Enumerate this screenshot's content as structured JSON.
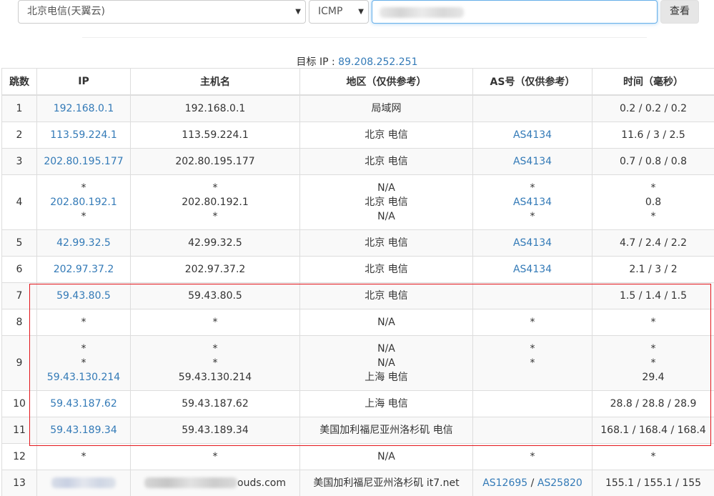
{
  "toolbar": {
    "region_value": "北京电信(天翼云)",
    "protocol_value": "ICMP",
    "query_label": "查看"
  },
  "target": {
    "label": "目标 IP : ",
    "ip": "89.208.252.251"
  },
  "table": {
    "headers": [
      "跳数",
      "IP",
      "主机名",
      "地区（仅供参考）",
      "AS号（仅供参考）",
      "时间（毫秒）"
    ],
    "rows": [
      {
        "hop": "1",
        "ips": [
          "192.168.0.1"
        ],
        "hosts": [
          "192.168.0.1"
        ],
        "regions": [
          "局域网"
        ],
        "asns": [],
        "times": [
          "0.2 / 0.2 / 0.2"
        ]
      },
      {
        "hop": "2",
        "ips": [
          "113.59.224.1"
        ],
        "hosts": [
          "113.59.224.1"
        ],
        "regions": [
          "北京 电信"
        ],
        "asns": [
          "AS4134"
        ],
        "times": [
          "11.6 / 3 / 2.5"
        ]
      },
      {
        "hop": "3",
        "ips": [
          "202.80.195.177"
        ],
        "hosts": [
          "202.80.195.177"
        ],
        "regions": [
          "北京 电信"
        ],
        "asns": [
          "AS4134"
        ],
        "times": [
          "0.7 / 0.8 / 0.8"
        ]
      },
      {
        "hop": "4",
        "ips": [
          "*",
          "202.80.192.1",
          "*"
        ],
        "hosts": [
          "*",
          "202.80.192.1",
          "*"
        ],
        "regions": [
          "N/A",
          "北京 电信",
          "N/A"
        ],
        "asns": [
          "*",
          "AS4134",
          "*"
        ],
        "times": [
          "*",
          "0.8",
          "*"
        ]
      },
      {
        "hop": "5",
        "ips": [
          "42.99.32.5"
        ],
        "hosts": [
          "42.99.32.5"
        ],
        "regions": [
          "北京 电信"
        ],
        "asns": [
          "AS4134"
        ],
        "times": [
          "4.7 / 2.4 / 2.2"
        ]
      },
      {
        "hop": "6",
        "ips": [
          "202.97.37.2"
        ],
        "hosts": [
          "202.97.37.2"
        ],
        "regions": [
          "北京 电信"
        ],
        "asns": [
          "AS4134"
        ],
        "times": [
          "2.1 / 3 / 2"
        ]
      },
      {
        "hop": "7",
        "ips": [
          "59.43.80.5"
        ],
        "hosts": [
          "59.43.80.5"
        ],
        "regions": [
          "北京 电信"
        ],
        "asns": [],
        "times": [
          "1.5 / 1.4 / 1.5"
        ]
      },
      {
        "hop": "8",
        "ips": [
          "*"
        ],
        "hosts": [
          "*"
        ],
        "regions": [
          "N/A"
        ],
        "asns": [
          "*"
        ],
        "times": [
          "*"
        ]
      },
      {
        "hop": "9",
        "ips": [
          "*",
          "*",
          "59.43.130.214"
        ],
        "hosts": [
          "*",
          "*",
          "59.43.130.214"
        ],
        "regions": [
          "N/A",
          "N/A",
          "上海 电信"
        ],
        "asns": [
          "*",
          "*",
          ""
        ],
        "times": [
          "*",
          "*",
          "29.4"
        ]
      },
      {
        "hop": "10",
        "ips": [
          "59.43.187.62"
        ],
        "hosts": [
          "59.43.187.62"
        ],
        "regions": [
          "上海 电信"
        ],
        "asns": [],
        "times": [
          "28.8 / 28.8 / 28.9"
        ]
      },
      {
        "hop": "11",
        "ips": [
          "59.43.189.34"
        ],
        "hosts": [
          "59.43.189.34"
        ],
        "regions": [
          "美国加利福尼亚州洛杉矶 电信"
        ],
        "asns": [],
        "times": [
          "168.1 / 168.4 / 168.4"
        ]
      },
      {
        "hop": "12",
        "ips": [
          "*"
        ],
        "hosts": [
          "*"
        ],
        "regions": [
          "N/A"
        ],
        "asns": [
          "*"
        ],
        "times": [
          "*"
        ]
      },
      {
        "hop": "13",
        "ips": [
          "[blurred]"
        ],
        "hosts": [
          "[blurred]ouds.com"
        ],
        "regions": [
          "美国加利福尼亚州洛杉矶 it7.net"
        ],
        "asns": [
          "AS12695",
          "AS25820"
        ],
        "asn_inline": true,
        "times": [
          "155.1 / 155.1 / 155"
        ]
      }
    ]
  },
  "colors": {
    "link": "#337ab7",
    "highlight_border": "#e3151b",
    "striped_row": "#f9f9f9"
  }
}
